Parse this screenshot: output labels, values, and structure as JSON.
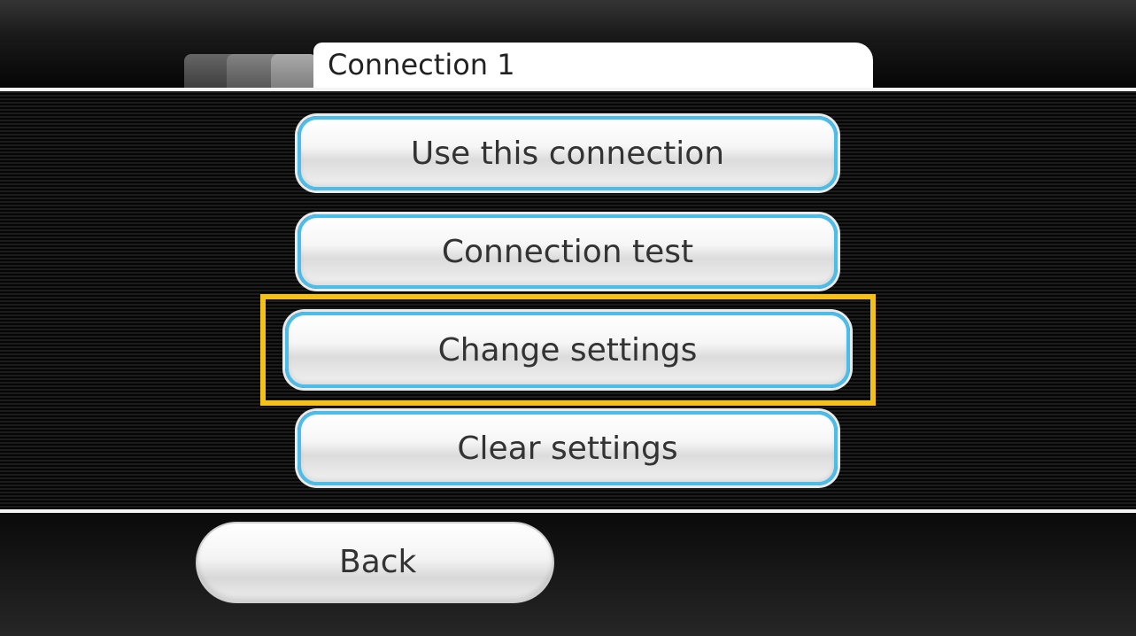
{
  "header": {
    "tab_title": "Connection 1"
  },
  "menu": {
    "buttons": [
      {
        "label": "Use this connection"
      },
      {
        "label": "Connection test"
      },
      {
        "label": "Change settings",
        "selected": true
      },
      {
        "label": "Clear settings"
      }
    ]
  },
  "footer": {
    "back_label": "Back"
  },
  "colors": {
    "button_border": "#4cbde8",
    "focus_highlight": "#f3c11a",
    "background": "#000000"
  }
}
